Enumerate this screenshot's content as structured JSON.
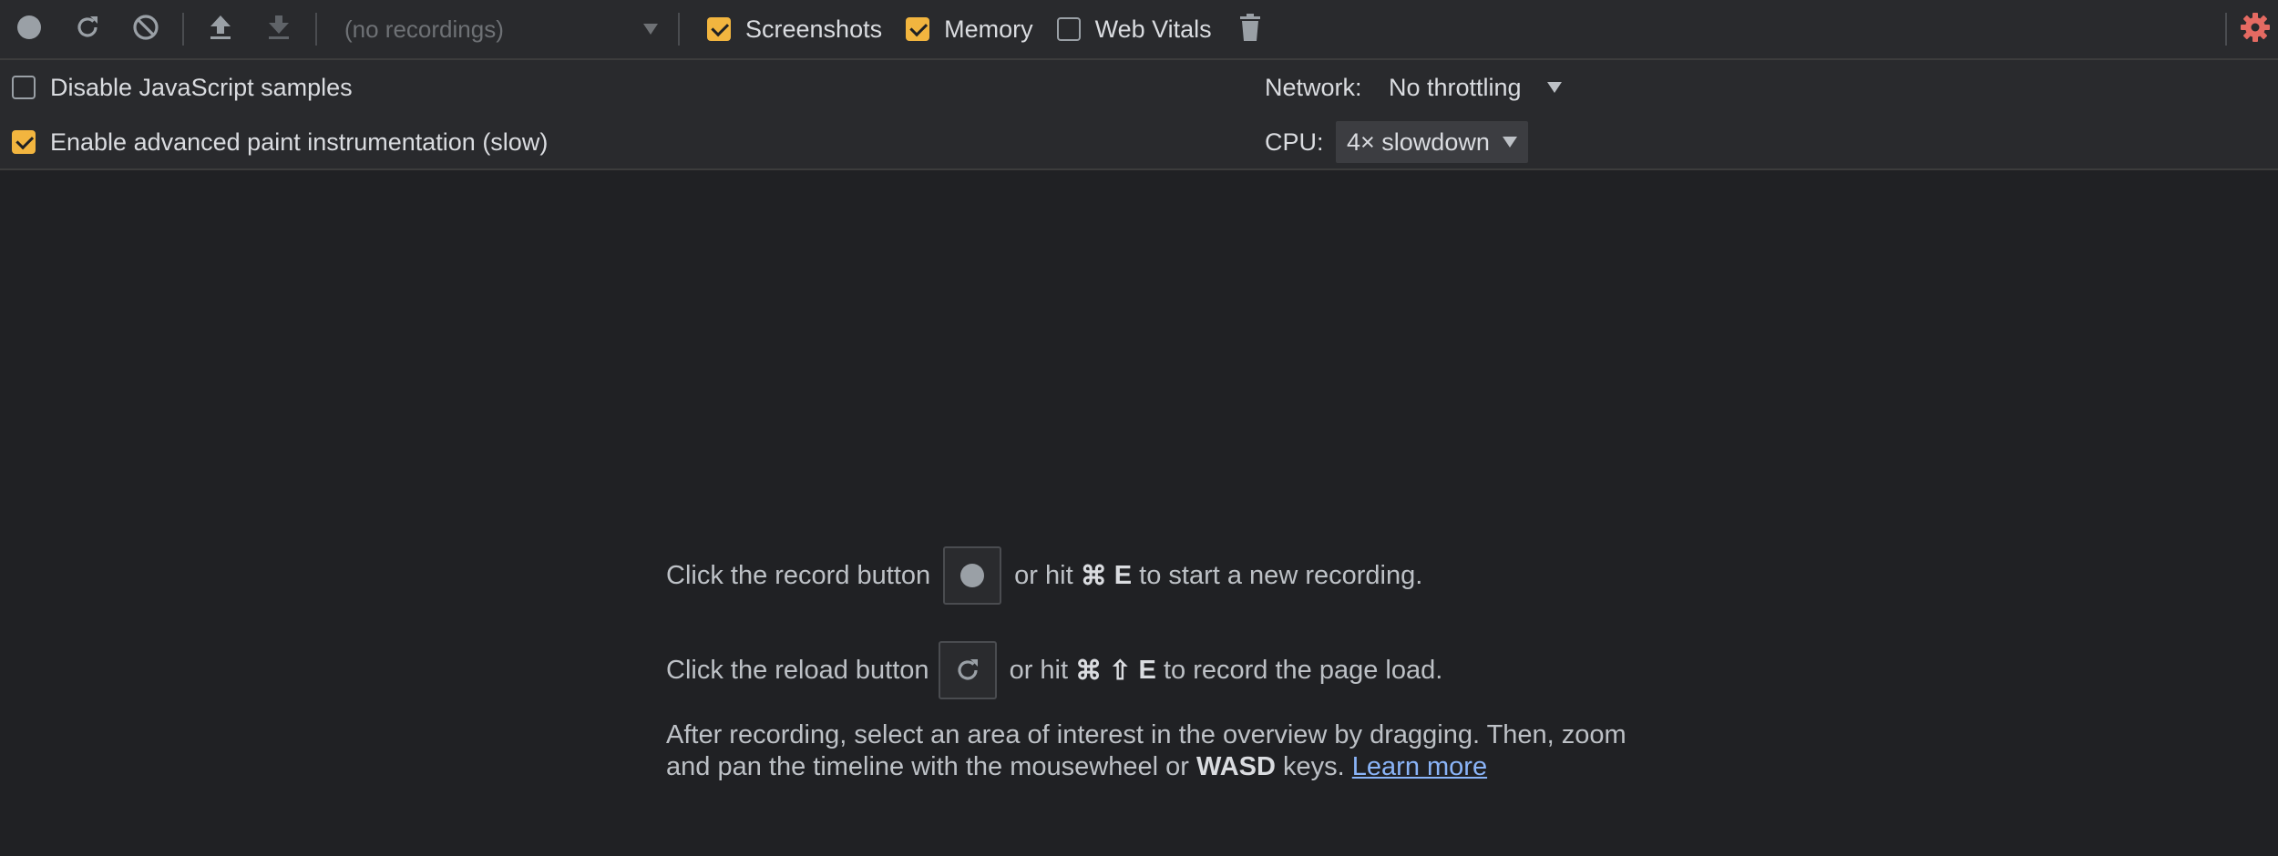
{
  "toolbar": {
    "recordings_placeholder": "(no recordings)",
    "checkboxes": [
      {
        "label": "Screenshots",
        "checked": true
      },
      {
        "label": "Memory",
        "checked": true
      },
      {
        "label": "Web Vitals",
        "checked": false
      }
    ],
    "icons": {
      "record": "record-icon",
      "reload": "reload-icon",
      "clear": "clear-icon",
      "load": "upload-icon",
      "save": "download-icon",
      "garbage": "trash-icon",
      "settings": "gear-icon"
    }
  },
  "settings": {
    "disable_js_samples": {
      "label": "Disable JavaScript samples",
      "checked": false
    },
    "advanced_paint": {
      "label": "Enable advanced paint instrumentation (slow)",
      "checked": true
    },
    "network_label": "Network:",
    "network_value": "No throttling",
    "cpu_label": "CPU:",
    "cpu_value": "4× slowdown"
  },
  "landing": {
    "record_prefix": "Click the record button",
    "record_mid": "or hit",
    "record_cmd": "⌘",
    "record_key": "E",
    "record_suffix": "to start a new recording.",
    "reload_prefix": "Click the reload button",
    "reload_mid": "or hit",
    "reload_cmd": "⌘",
    "reload_shift": "⇧",
    "reload_key": "E",
    "reload_suffix": "to record the page load.",
    "after_1": "After recording, select an area of interest in the overview by dragging. Then, zoom and pan the timeline with the mousewheel or",
    "after_keys": "WASD",
    "after_2": "keys.",
    "learn_more": "Learn more"
  },
  "colors": {
    "background": "#202124",
    "toolbar": "#292a2d",
    "checkbox_accent": "#f2b53f",
    "link": "#8ab4f8",
    "settings_gear": "#e46a62"
  }
}
